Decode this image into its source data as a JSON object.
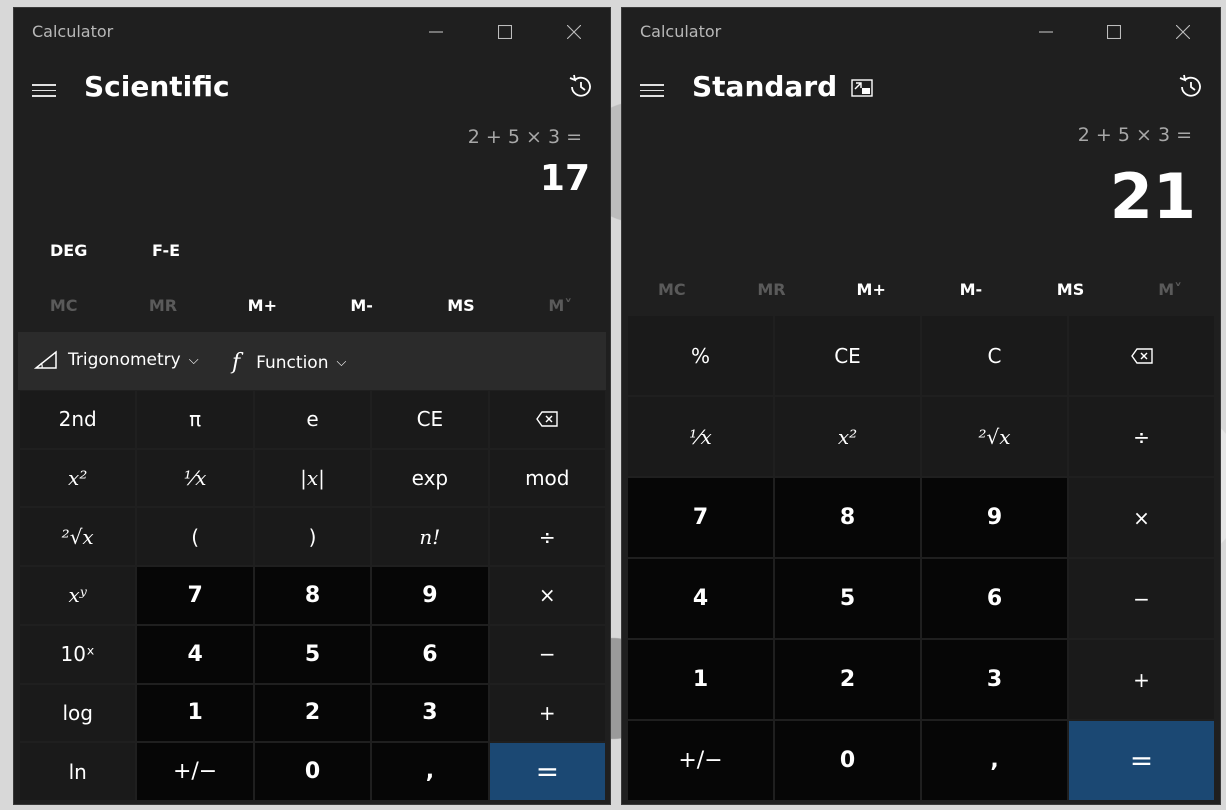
{
  "sci": {
    "title": "Calculator",
    "mode": "Scientific",
    "expression": "2 + 5 × 3 =",
    "result": "17",
    "angle": "DEG",
    "fe": "F-E",
    "memory": [
      "MC",
      "MR",
      "M+",
      "M-",
      "MS",
      "M˅"
    ],
    "trig": "Trigonometry",
    "function": "Function",
    "keys": {
      "r1": [
        "2nd",
        "π",
        "e",
        "CE",
        "backspace"
      ],
      "r2": [
        "x²",
        "⅟x",
        "|x|",
        "exp",
        "mod"
      ],
      "r3": [
        "²√x",
        "(",
        ")",
        "n!",
        "÷"
      ],
      "r4": [
        "xʸ",
        "7",
        "8",
        "9",
        "×"
      ],
      "r5": [
        "10ˣ",
        "4",
        "5",
        "6",
        "−"
      ],
      "r6": [
        "log",
        "1",
        "2",
        "3",
        "+"
      ],
      "r7": [
        "ln",
        "+/−",
        "0",
        ",",
        "="
      ]
    }
  },
  "std": {
    "title": "Calculator",
    "mode": "Standard",
    "expression": "2 + 5 × 3 =",
    "result": "21",
    "memory": [
      "MC",
      "MR",
      "M+",
      "M-",
      "MS",
      "M˅"
    ],
    "keys": {
      "r1": [
        "%",
        "CE",
        "C",
        "backspace"
      ],
      "r2": [
        "⅟x",
        "x²",
        "²√x",
        "÷"
      ],
      "r3": [
        "7",
        "8",
        "9",
        "×"
      ],
      "r4": [
        "4",
        "5",
        "6",
        "−"
      ],
      "r5": [
        "1",
        "2",
        "3",
        "+"
      ],
      "r6": [
        "+/−",
        "0",
        ",",
        "="
      ]
    }
  },
  "colors": {
    "accent": "#1b4873",
    "window": "#1f1f1f",
    "numkey": "#060606",
    "fnkey": "#1a1a1a"
  }
}
